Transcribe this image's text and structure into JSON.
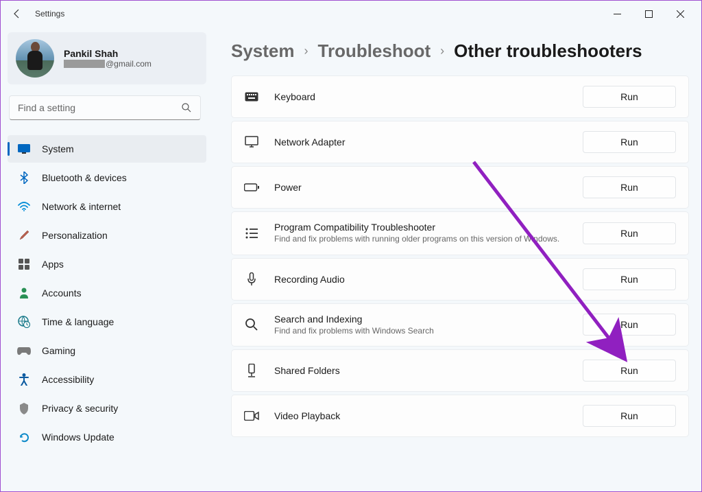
{
  "window": {
    "title": "Settings"
  },
  "profile": {
    "name": "Pankil Shah",
    "email_suffix": "@gmail.com"
  },
  "search": {
    "placeholder": "Find a setting"
  },
  "nav": {
    "items": [
      {
        "label": "System",
        "icon": "monitor-icon",
        "active": true
      },
      {
        "label": "Bluetooth & devices",
        "icon": "bluetooth-icon"
      },
      {
        "label": "Network & internet",
        "icon": "wifi-icon"
      },
      {
        "label": "Personalization",
        "icon": "brush-icon"
      },
      {
        "label": "Apps",
        "icon": "apps-icon"
      },
      {
        "label": "Accounts",
        "icon": "person-icon"
      },
      {
        "label": "Time & language",
        "icon": "globe-clock-icon"
      },
      {
        "label": "Gaming",
        "icon": "gamepad-icon"
      },
      {
        "label": "Accessibility",
        "icon": "accessibility-icon"
      },
      {
        "label": "Privacy & security",
        "icon": "shield-icon"
      },
      {
        "label": "Windows Update",
        "icon": "update-icon"
      }
    ]
  },
  "breadcrumb": {
    "part1": "System",
    "part2": "Troubleshoot",
    "part3": "Other troubleshooters",
    "sep": "›"
  },
  "troubleshooters": [
    {
      "label": "Keyboard",
      "desc": "",
      "icon": "keyboard-icon",
      "run": "Run"
    },
    {
      "label": "Network Adapter",
      "desc": "",
      "icon": "monitor-network-icon",
      "run": "Run"
    },
    {
      "label": "Power",
      "desc": "",
      "icon": "battery-icon",
      "run": "Run"
    },
    {
      "label": "Program Compatibility Troubleshooter",
      "desc": "Find and fix problems with running older programs on this version of Windows.",
      "icon": "list-icon",
      "run": "Run"
    },
    {
      "label": "Recording Audio",
      "desc": "",
      "icon": "microphone-icon",
      "run": "Run"
    },
    {
      "label": "Search and Indexing",
      "desc": "Find and fix problems with Windows Search",
      "icon": "search-icon",
      "run": "Run"
    },
    {
      "label": "Shared Folders",
      "desc": "",
      "icon": "device-stand-icon",
      "run": "Run"
    },
    {
      "label": "Video Playback",
      "desc": "",
      "icon": "video-icon",
      "run": "Run"
    }
  ]
}
